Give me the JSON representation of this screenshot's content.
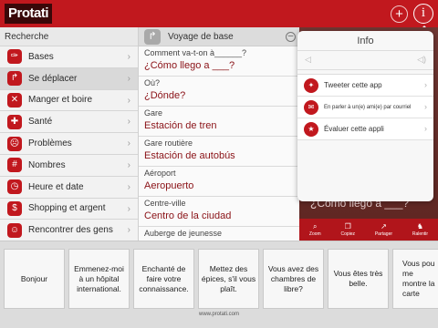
{
  "header": {
    "logo": "Protati",
    "add_label": "+",
    "info_label": "i"
  },
  "sidebar": {
    "title": "Recherche",
    "items": [
      {
        "label": "Bases",
        "icon": "seat-icon",
        "glyph": "✑"
      },
      {
        "label": "Se déplacer",
        "icon": "turn-arrow-icon",
        "glyph": "↱"
      },
      {
        "label": "Manger et boire",
        "icon": "utensils-icon",
        "glyph": "✕"
      },
      {
        "label": "Santé",
        "icon": "first-aid-icon",
        "glyph": "✚"
      },
      {
        "label": "Problèmes",
        "icon": "sad-face-icon",
        "glyph": "☹"
      },
      {
        "label": "Nombres",
        "icon": "numbers-icon",
        "glyph": "#"
      },
      {
        "label": "Heure et date",
        "icon": "clock-icon",
        "glyph": "◷"
      },
      {
        "label": "Shopping et argent",
        "icon": "money-icon",
        "glyph": "$"
      },
      {
        "label": "Rencontrer des gens",
        "icon": "people-icon",
        "glyph": "☺"
      }
    ]
  },
  "phrases": {
    "title": "Voyage de base",
    "items": [
      {
        "fr": "Comment va-t-on à______?",
        "es": "¿Cómo llego a ___?"
      },
      {
        "fr": "Où?",
        "es": "¿Dónde?"
      },
      {
        "fr": "Gare",
        "es": "Estación de tren"
      },
      {
        "fr": "Gare routière",
        "es": "Estación de autobús"
      },
      {
        "fr": "Aéroport",
        "es": "Aeropuerto"
      },
      {
        "fr": "Centre-ville",
        "es": "Centro de la ciudad"
      },
      {
        "fr": "Auberge de jeunesse",
        "es": ""
      }
    ]
  },
  "photo": {
    "text": "¿Cómo llego a ___?",
    "tools": [
      {
        "label": "Zoom",
        "icon": "zoom-icon",
        "glyph": "⌕"
      },
      {
        "label": "Copiez",
        "icon": "copy-icon",
        "glyph": "❐"
      },
      {
        "label": "Partager",
        "icon": "share-icon",
        "glyph": "↗"
      },
      {
        "label": "Ralentir",
        "icon": "slow-icon",
        "glyph": "♞"
      }
    ]
  },
  "info_popover": {
    "title": "Info",
    "items": [
      {
        "label": "Tweeter cette app",
        "icon": "twitter-icon",
        "glyph": "✦"
      },
      {
        "label": "En parler à un(e) ami(e) par courriel",
        "icon": "mail-icon",
        "glyph": "✉"
      },
      {
        "label": "Évaluer cette appli",
        "icon": "star-icon",
        "glyph": "★"
      }
    ]
  },
  "quick_phrases": [
    "Bonjour",
    "Emmenez-moi à un hôpital international.",
    "Enchanté de faire votre connaissance.",
    "Mettez des épices, s'il vous plaît.",
    "Vous avez des chambres de libre?",
    "Vous êtes très belle.",
    "Vous pou me montre la carte"
  ],
  "footer": {
    "url": "www.protati.com"
  },
  "colors": {
    "brand_red": "#c1181e",
    "phrase_red": "#8a1116"
  }
}
